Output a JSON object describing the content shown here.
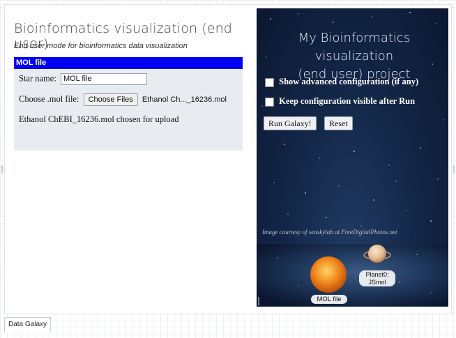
{
  "left": {
    "title": "Bioinformatics visualization (end user)",
    "subtitle": "End user mode for bioinformatics data visualization",
    "mol_card": {
      "header": "MOL file",
      "star_name_label": "Star name:",
      "star_name_value": "MOL file",
      "choose_label": "Choose .mol file:",
      "choose_button": "Choose Files",
      "chosen_file": "Ethanol Ch..._16236.mol",
      "upload_status": "Ethanol ChEBI_16236.mol chosen for upload"
    }
  },
  "right": {
    "project_title_line1": "My Bioinformatics visualization",
    "project_title_line2": "(end user) project",
    "option_advanced": "Show advanced configuration (if any)",
    "option_keep_visible": "Keep configuration visible after Run",
    "run_button": "Run Galaxy!",
    "reset_button": "Reset",
    "image_credit": "Image courtesy of seaskylab at FreeDigitalPhotos.net",
    "galaxy": {
      "star_label": "MOL file",
      "planet_label_line1": "Planet0:",
      "planet_label_line2": "JSmol"
    }
  },
  "bottom_tab": {
    "label": "Data Galaxy"
  },
  "colors": {
    "header_blue": "#0000f0",
    "panel_bg": "#e8ecf1",
    "sky_dark": "#0b1730"
  }
}
